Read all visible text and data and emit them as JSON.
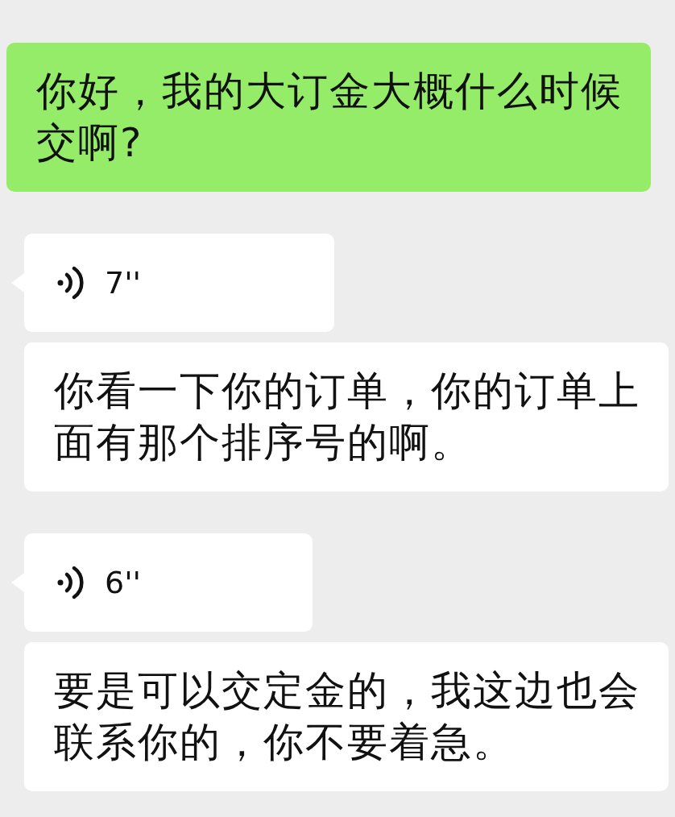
{
  "messages": [
    {
      "kind": "text",
      "outgoing": true,
      "text": "你好，我的大订金大概什么时候交啊?"
    },
    {
      "kind": "voice",
      "outgoing": false,
      "duration": "7''",
      "transcription": "你看一下你的订单，你的订单上面有那个排序号的啊。"
    },
    {
      "kind": "voice",
      "outgoing": false,
      "duration": "6''",
      "transcription": "要是可以交定金的，我这边也会联系你的，你不要着急。"
    }
  ]
}
